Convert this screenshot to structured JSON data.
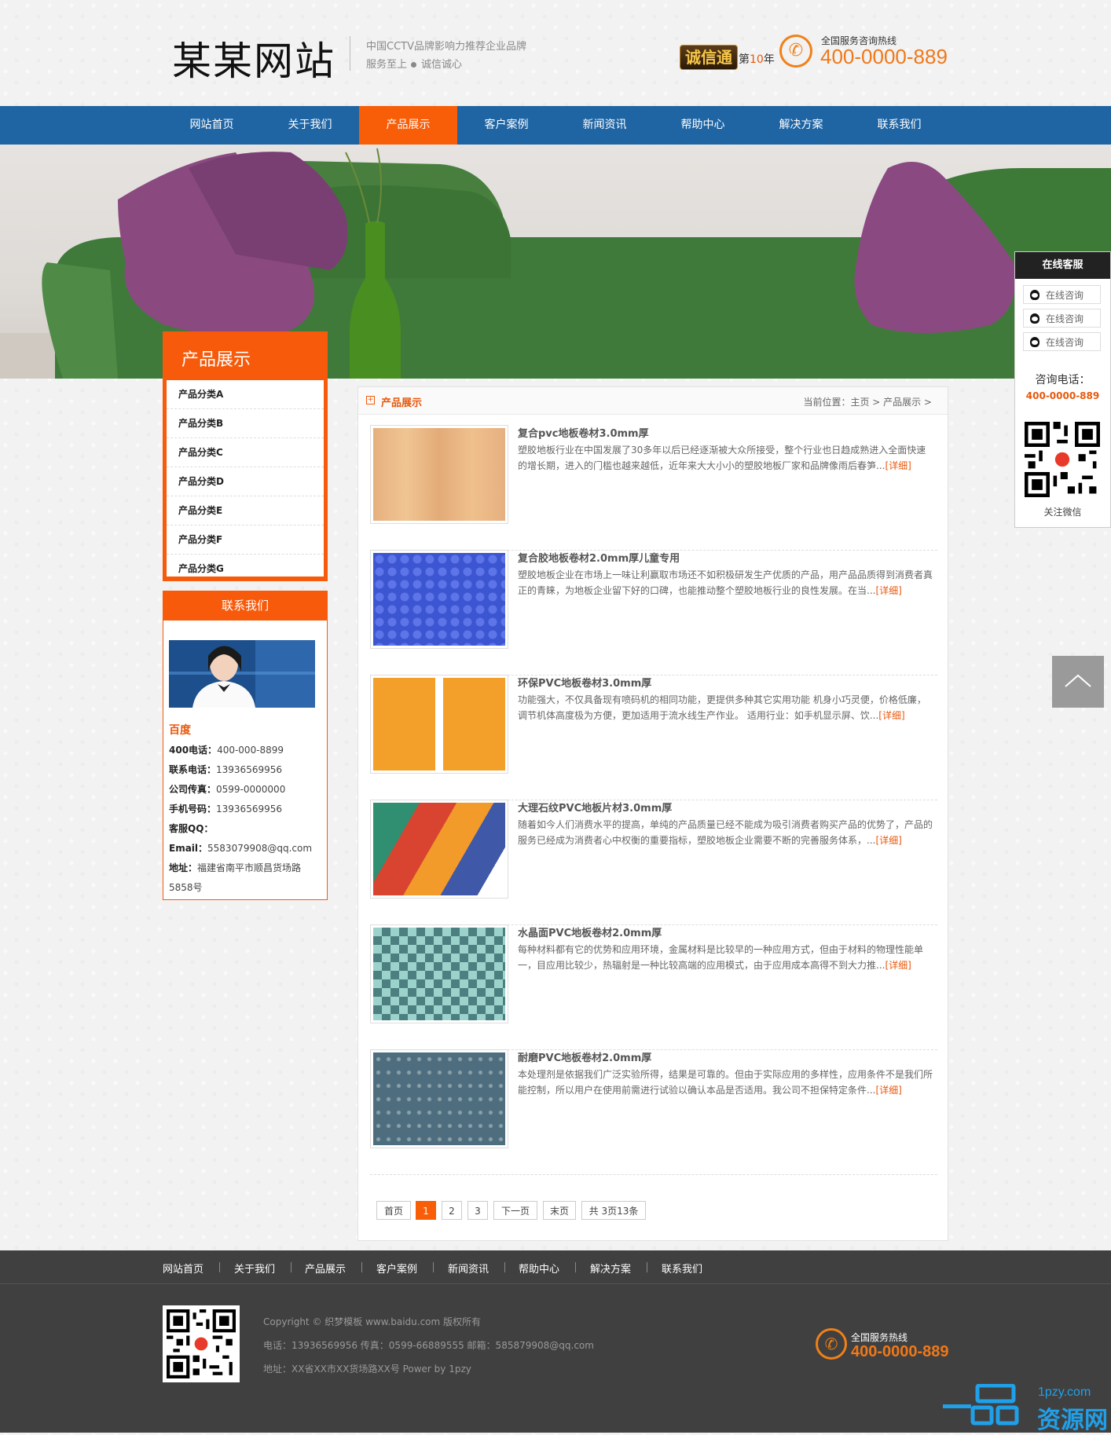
{
  "header": {
    "logo": "某某网站",
    "slogan_line1": "中国CCTV品牌影响力推荐企业品牌",
    "slogan_line2a": "服务至上",
    "slogan_line2b": "诚信诚心",
    "credit_badge": "诚信通",
    "year_prefix": "第",
    "year_value": "10",
    "year_suffix": "年",
    "hotline_label": "全国服务咨询热线",
    "hotline_number": "400-0000-889"
  },
  "nav": {
    "items": [
      "网站首页",
      "关于我们",
      "产品展示",
      "客户案例",
      "新闻资讯",
      "帮助中心",
      "解决方案",
      "联系我们"
    ],
    "active": "产品展示"
  },
  "sidebar": {
    "title": "产品展示",
    "categories": [
      "产品分类A",
      "产品分类B",
      "产品分类C",
      "产品分类D",
      "产品分类E",
      "产品分类F",
      "产品分类G"
    ]
  },
  "contact": {
    "title": "联系我们",
    "company": "百度",
    "lines": [
      {
        "label": "400电话：",
        "value": "400-000-8899"
      },
      {
        "label": "联系电话：",
        "value": "13936569956"
      },
      {
        "label": "公司传真：",
        "value": "0599-0000000"
      },
      {
        "label": "手机号码：",
        "value": "13936569956"
      },
      {
        "label": "客服QQ：",
        "value": ""
      },
      {
        "label": "Email：",
        "value": "5583079908@qq.com"
      },
      {
        "label": "地址：",
        "value": "福建省南平市顺昌货场路"
      },
      {
        "label": "",
        "value": "5858号"
      }
    ]
  },
  "main": {
    "title": "产品展示",
    "breadcrumb": "当前位置：主页 > 产品展示 >",
    "more_label": "[详细]",
    "products": [
      {
        "title": "复合pvc地板卷材3.0mm厚",
        "desc": "塑胶地板行业在中国发展了30多年以后已经逐渐被大众所接受，整个行业也日趋成熟进入全面快速的增长期，进入的门槛也越来越低，近年来大大小小的塑胶地板厂家和品牌像雨后春笋..."
      },
      {
        "title": "复合胶地板卷材2.0mm厚儿童专用",
        "desc": "塑胶地板企业在市场上一味让利赢取市场还不如积极研发生产优质的产品，用产品品质得到消费者真正的青睐，为地板企业留下好的口碑，也能推动整个塑胶地板行业的良性发展。在当..."
      },
      {
        "title": "环保PVC地板卷材3.0mm厚",
        "desc": "功能强大，不仅具备现有喷码机的相同功能，更提供多种其它实用功能 机身小巧灵便，价格低廉，调节机体高度极为方便，更加适用于流水线生产作业。 适用行业：如手机显示屏、饮..."
      },
      {
        "title": "大理石纹PVC地板片材3.0mm厚",
        "desc": "随着如今人们消费水平的提高，单纯的产品质量已经不能成为吸引消费者购买产品的优势了，产品的服务已经成为消费者心中权衡的重要指标，塑胶地板企业需要不断的完善服务体系，..."
      },
      {
        "title": "水晶面PVC地板卷材2.0mm厚",
        "desc": "每种材料都有它的优势和应用环境，金属材料是比较早的一种应用方式，但由于材料的物理性能单一，目应用比较少，热辐射是一种比较高端的应用模式，由于应用成本高得不到大力推..."
      },
      {
        "title": "耐磨PVC地板卷材2.0mm厚",
        "desc": "本处理剂是依据我们广泛实验所得，结果是可靠的。但由于实际应用的多样性，应用条件不是我们所能控制，所以用户在使用前需进行试验以确认本品是否适用。我公司不担保特定条件..."
      }
    ],
    "pagination": {
      "first": "首页",
      "pages": [
        "1",
        "2",
        "3"
      ],
      "current": "1",
      "next": "下一页",
      "last": "末页",
      "summary": "共 3页13条"
    }
  },
  "footer": {
    "links": [
      "网站首页",
      "关于我们",
      "产品展示",
      "客户案例",
      "新闻资讯",
      "帮助中心",
      "解决方案",
      "联系我们"
    ],
    "copyright": "Copyright © 织梦模板 www.baidu.com 版权所有",
    "contact_line": "电话：13936569956 传真：0599-66889555 邮箱：585879908@qq.com",
    "address_line": "地址：XX省XX市XX货场路XX号 Power by 1pzy",
    "hotline_label": "全国服务热线",
    "hotline_number": "400-0000-889"
  },
  "customer_service": {
    "title": "在线客服",
    "buttons": [
      "在线咨询",
      "在线咨询",
      "在线咨询"
    ],
    "phone_label": "咨询电话：",
    "phone": "400-0000-889",
    "follow_label": "关注微信"
  },
  "watermark": {
    "domain": "1pzy.com",
    "name": "资源网"
  },
  "colors": {
    "nav_blue": "#1f64a3",
    "accent_orange": "#f85d08",
    "footer_bg": "#404040"
  }
}
